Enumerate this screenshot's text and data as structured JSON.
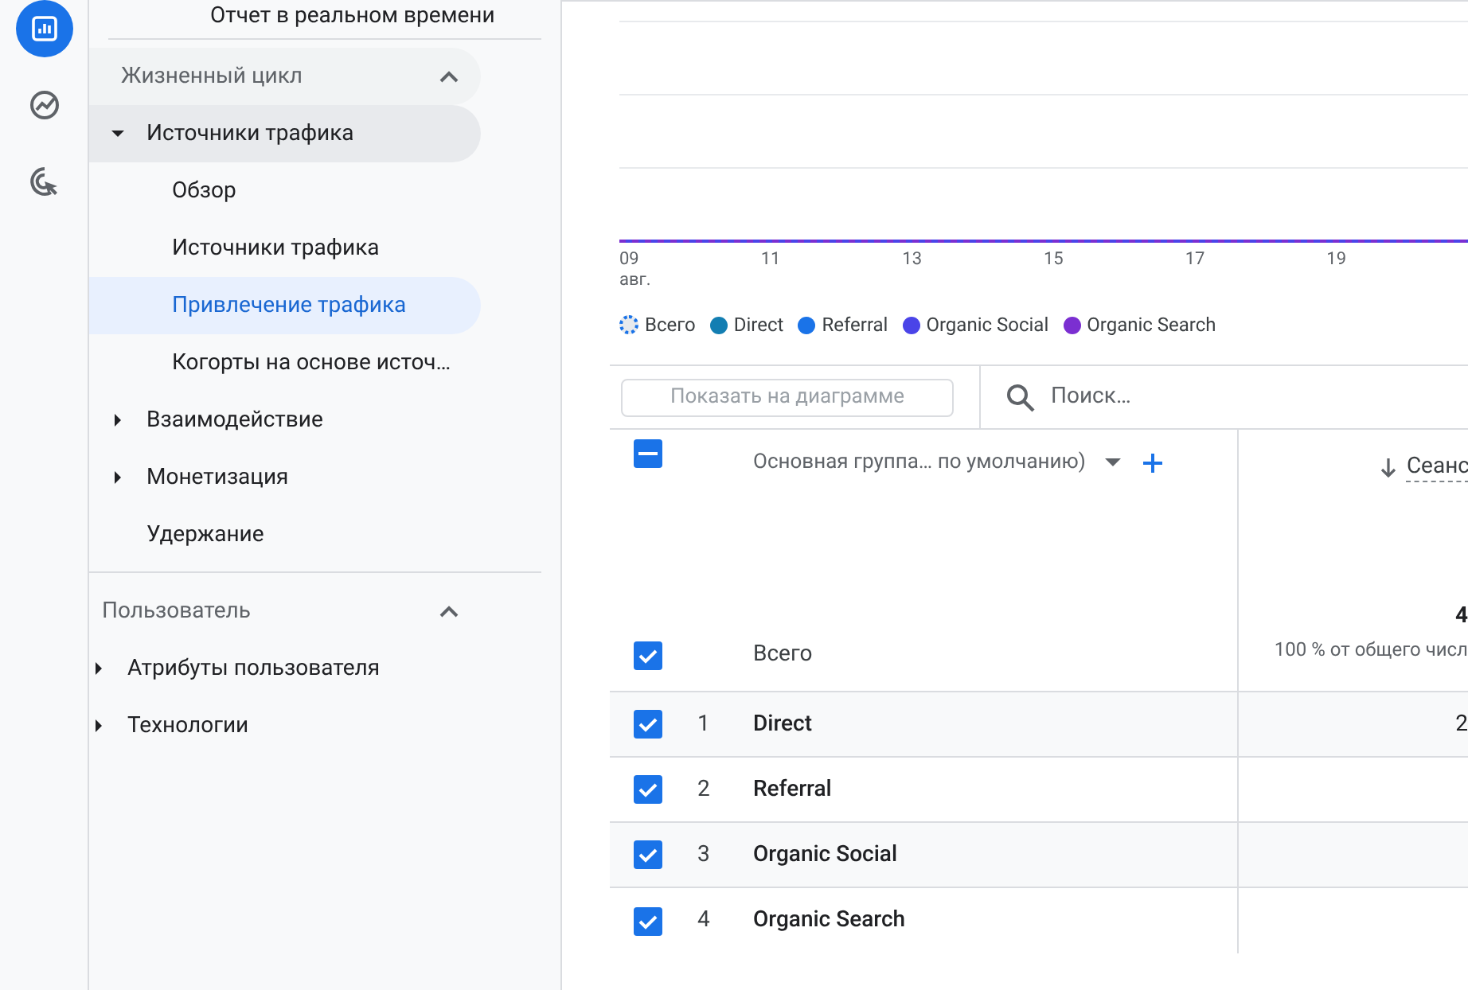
{
  "rail": [
    {
      "kind": "reports",
      "selected": true
    },
    {
      "kind": "explore",
      "selected": false
    },
    {
      "kind": "advertising",
      "selected": false
    }
  ],
  "sidebar": {
    "top_item": "Отчет в реальном времени",
    "sections": [
      {
        "title": "Жизненный цикл",
        "expanded": true,
        "items": [
          {
            "label": "Источники трафика",
            "expanded": true,
            "has_children": true,
            "selected": false,
            "children": [
              {
                "label": "Обзор",
                "selected": false
              },
              {
                "label": "Источники трафика",
                "selected": false
              },
              {
                "label": "Привлечение трафика",
                "selected": true
              },
              {
                "label": "Когорты на основе источ…",
                "selected": false
              }
            ]
          },
          {
            "label": "Взаимодействие",
            "expanded": false,
            "has_children": true,
            "selected": false
          },
          {
            "label": "Монетизация",
            "expanded": false,
            "has_children": true,
            "selected": false
          },
          {
            "label": "Удержание",
            "expanded": false,
            "has_children": false,
            "selected": false
          }
        ]
      },
      {
        "title": "Пользователь",
        "expanded": true,
        "items": [
          {
            "label": "Атрибуты пользователя",
            "expanded": false,
            "has_children": true,
            "selected": false
          },
          {
            "label": "Технологии",
            "expanded": false,
            "has_children": true,
            "selected": false
          }
        ]
      }
    ]
  },
  "chart": {
    "x_labels": [
      "09",
      "11",
      "13",
      "15",
      "17",
      "19"
    ],
    "month": "авг.",
    "legend": [
      {
        "label": "Всего",
        "kind": "total",
        "color": "#1a73e8"
      },
      {
        "label": "Direct",
        "kind": "series",
        "color": "#137eb2"
      },
      {
        "label": "Referral",
        "kind": "series",
        "color": "#1a73e8"
      },
      {
        "label": "Organic Social",
        "kind": "series",
        "color": "#4a44e8"
      },
      {
        "label": "Organic Search",
        "kind": "series",
        "color": "#7b2fd1"
      }
    ]
  },
  "toolbar": {
    "plot_button": "Показать на диаграмме",
    "plot_disabled": true,
    "search_placeholder": "Поиск…"
  },
  "table": {
    "select_all": {
      "checked": true,
      "indeterminate": true
    },
    "dimension_header": "Основная группа… по умолчанию)",
    "metric_header": "Сеанс",
    "total": {
      "label": "Всего",
      "checked": true,
      "value": "4",
      "share": "100 % от общего числ"
    },
    "rows": [
      {
        "index": "1",
        "name": "Direct",
        "checked": true,
        "value": "2"
      },
      {
        "index": "2",
        "name": "Referral",
        "checked": true
      },
      {
        "index": "3",
        "name": "Organic Social",
        "checked": true
      },
      {
        "index": "4",
        "name": "Organic Search",
        "checked": true
      }
    ]
  }
}
